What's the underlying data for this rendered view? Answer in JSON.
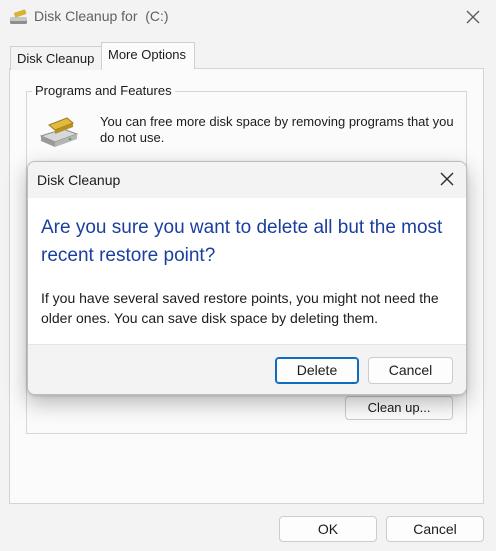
{
  "window": {
    "title": "Disk Cleanup for  (C:)",
    "close_icon": "close-icon"
  },
  "tabs": [
    {
      "label": "Disk Cleanup",
      "active": false
    },
    {
      "label": "More Options",
      "active": true
    }
  ],
  "programs_group": {
    "title": "Programs and Features",
    "icon": "programs-drive-icon",
    "description": "You can free more disk space by removing programs that you do not use."
  },
  "restore_group": {
    "cleanup_label": "Clean up..."
  },
  "footer": {
    "ok_label": "OK",
    "cancel_label": "Cancel"
  },
  "dialog": {
    "title": "Disk Cleanup",
    "heading": "Are you sure you want to delete all but the most recent restore point?",
    "body": "If you have several saved restore points, you might not need the older ones. You can save disk space by deleting them.",
    "delete_label": "Delete",
    "cancel_label": "Cancel",
    "accent": "#0f6cbd",
    "heading_color": "#1a3f9e"
  }
}
